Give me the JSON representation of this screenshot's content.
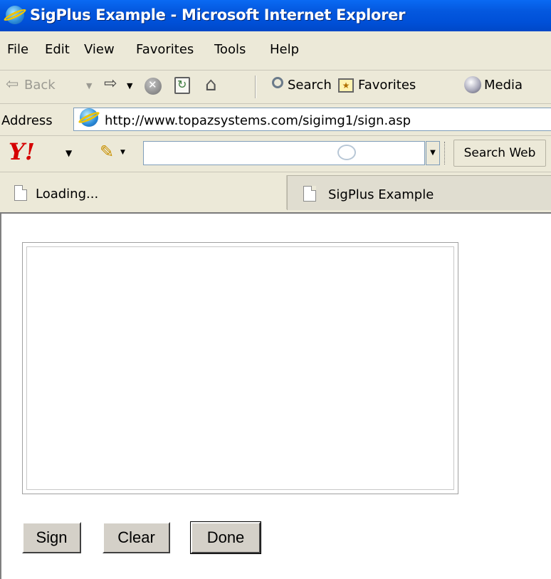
{
  "window": {
    "title": "SigPlus Example - Microsoft Internet Explorer"
  },
  "menu": [
    "File",
    "Edit",
    "View",
    "Favorites",
    "Tools",
    "Help"
  ],
  "toolbar": {
    "back_label": "Back",
    "search_label": "Search",
    "favorites_label": "Favorites",
    "media_label": "Media"
  },
  "address": {
    "label": "Address",
    "url": "http://www.topazsystems.com/sigimg1/sign.asp"
  },
  "yahoo": {
    "logo": "Y!",
    "search_value": "",
    "search_button": "Search Web"
  },
  "tabs": [
    {
      "label": "Loading...",
      "active": false
    },
    {
      "label": "SigPlus Example",
      "active": true
    }
  ],
  "buttons": {
    "sign": "Sign",
    "clear": "Clear",
    "done": "Done"
  }
}
